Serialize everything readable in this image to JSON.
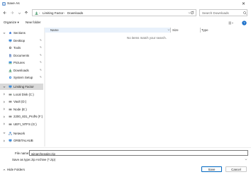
{
  "window": {
    "title": "Save As",
    "close_icon": "close-icon"
  },
  "nav": {
    "breadcrumb": [
      "Limiting Factor",
      "Downloads"
    ],
    "search_placeholder": "Search Downloads"
  },
  "toolbar": {
    "organize_label": "Organize ▾",
    "new_folder_label": "New folder"
  },
  "sidebar": {
    "items": [
      {
        "label": "Sections",
        "icon": "star-icon",
        "level": 0,
        "expanded": true
      },
      {
        "label": "Desktop",
        "icon": "desktop-icon",
        "pinned": true
      },
      {
        "label": "Tools",
        "icon": "gear-icon",
        "pinned": true
      },
      {
        "label": "Documents",
        "icon": "document-icon",
        "pinned": true
      },
      {
        "label": "Pictures",
        "icon": "picture-icon",
        "pinned": true
      },
      {
        "label": "Downloads",
        "icon": "download-icon",
        "pinned": true
      },
      {
        "label": "System Setup",
        "icon": "gear-icon",
        "pinned": true
      },
      {
        "label": "Limiting Factor",
        "icon": "pc-icon",
        "level": 0,
        "expanded": true,
        "selected": true
      },
      {
        "label": "Local Disk (C:)",
        "icon": "drive-icon"
      },
      {
        "label": "Vault (D:)",
        "icon": "drive-icon"
      },
      {
        "label": "Node (E:)",
        "icon": "drive-icon"
      },
      {
        "label": "2200_831_ProfN (F:)",
        "icon": "drive-icon"
      },
      {
        "label": "UEFI_NTFS (G:)",
        "icon": "drive-icon"
      },
      {
        "label": "Network",
        "icon": "network-icon",
        "level": 0,
        "expanded": true
      },
      {
        "label": "ORBITALHUB",
        "icon": "pc-icon"
      }
    ]
  },
  "list": {
    "columns": [
      "Name",
      "Size",
      "Type"
    ],
    "empty_message": "No items match your search."
  },
  "form": {
    "file_name_label": "File name:",
    "file_name_value": "winarcheealer.zip",
    "save_type_label": "Save as type:",
    "save_type_value": ".zip Archive (*.zip)"
  },
  "footer": {
    "hide_folders_label": "Hide Folders",
    "save_label": "Save",
    "cancel_label": "Cancel"
  },
  "colors": {
    "accent": "#0067c0",
    "selection": "#d9d9d9",
    "header_highlight": "#e8f1fb"
  }
}
